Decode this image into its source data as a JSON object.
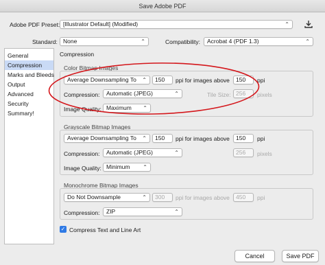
{
  "window": {
    "title": "Save Adobe PDF"
  },
  "preset": {
    "label": "Adobe PDF Preset:",
    "value": "[Illustrator Default] (Modified)"
  },
  "standard": {
    "label": "Standard:",
    "value": "None"
  },
  "compatibility": {
    "label": "Compatibility:",
    "value": "Acrobat 4 (PDF 1.3)"
  },
  "sidebar": {
    "items": [
      {
        "label": "General"
      },
      {
        "label": "Compression"
      },
      {
        "label": "Marks and Bleeds"
      },
      {
        "label": "Output"
      },
      {
        "label": "Advanced"
      },
      {
        "label": "Security"
      },
      {
        "label": "Summary!"
      }
    ]
  },
  "main": {
    "heading": "Compression",
    "color": {
      "title": "Color Bitmap Images",
      "downsample": "Average Downsampling To",
      "ppi": "150",
      "ppi_label": "ppi for images above",
      "above": "150",
      "above_unit": "ppi",
      "compression_label": "Compression:",
      "compression": "Automatic (JPEG)",
      "tile_label": "Tile Size:",
      "tile": "256",
      "tile_unit": "pixels",
      "quality_label": "Image Quality:",
      "quality": "Maximum"
    },
    "grayscale": {
      "title": "Grayscale Bitmap Images",
      "downsample": "Average Downsampling To",
      "ppi": "150",
      "ppi_label": "ppi for images above",
      "above": "150",
      "above_unit": "ppi",
      "compression_label": "Compression:",
      "compression": "Automatic (JPEG)",
      "tile": "256",
      "tile_unit": "pixels",
      "quality_label": "Image Quality:",
      "quality": "Minimum"
    },
    "monochrome": {
      "title": "Monochrome Bitmap Images",
      "downsample": "Do Not Downsample",
      "ppi": "300",
      "ppi_label": "ppi for images above",
      "above": "450",
      "above_unit": "ppi",
      "compression_label": "Compression:",
      "compression": "ZIP"
    },
    "compress_text": {
      "label": "Compress Text and Line Art",
      "checked": true
    }
  },
  "buttons": {
    "cancel": "Cancel",
    "save": "Save PDF"
  },
  "colors": {
    "accent": "#2f7ae5",
    "highlight_ellipse": "#d4161b",
    "sidebar_selected": "#c9daf5"
  },
  "icons": {
    "chevron": "chevron-updown-icon",
    "save_preset": "download-icon"
  }
}
